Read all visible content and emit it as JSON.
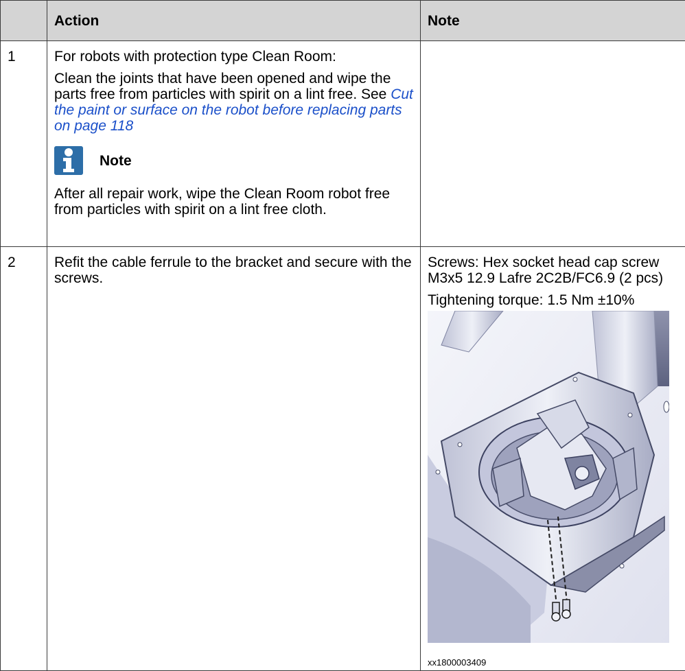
{
  "header": {
    "action": "Action",
    "note": "Note"
  },
  "rows": [
    {
      "num": "1",
      "action_intro": "For robots with protection type Clean Room:",
      "action_text": "Clean the joints that have been opened and wipe the parts free from particles with spirit on a lint free. See ",
      "action_link": "Cut the paint or surface on the robot before replacing parts on page 118",
      "note_title": "Note",
      "note_icon": "info-icon",
      "note_body": "After all repair work, wipe the Clean Room robot free from particles with spirit on a lint free cloth."
    },
    {
      "num": "2",
      "action_text": "Refit the cable ferrule to the bracket and secure with the screws.",
      "note_screws": "Screws: Hex socket head cap screw M3x5 12.9 Lafre 2C2B/FC6.9 (2 pcs)",
      "note_torque": "Tightening torque: 1.5 Nm ±10%",
      "figure_caption": "xx1800003409"
    }
  ],
  "colors": {
    "header_bg": "#d4d4d4",
    "link": "#1a4fc9",
    "note_icon": "#2d6ea8",
    "border": "#3a3a3a"
  }
}
